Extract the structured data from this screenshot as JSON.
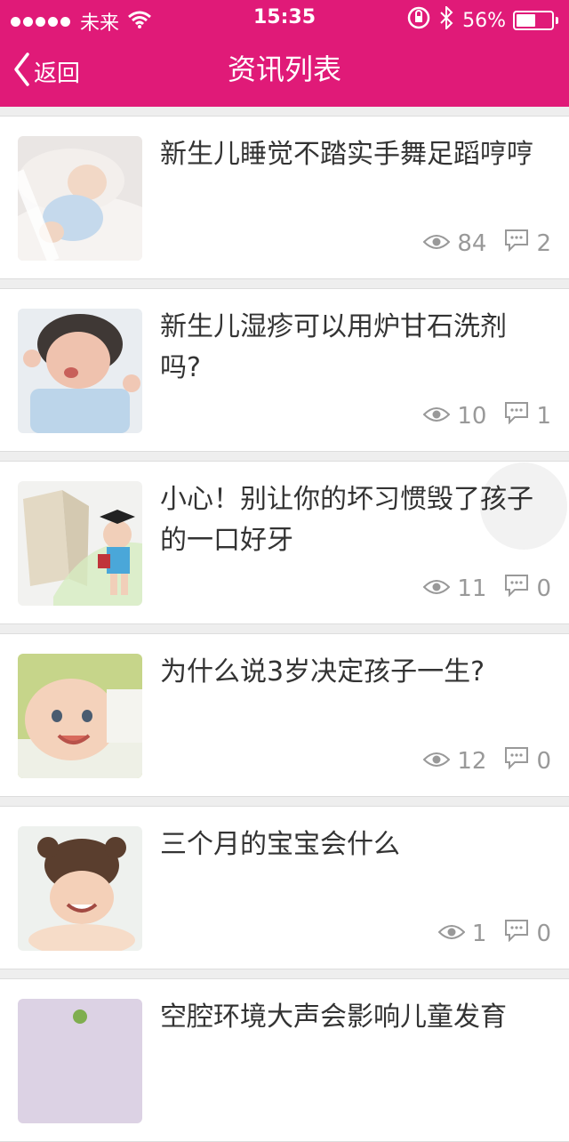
{
  "status_bar": {
    "carrier": "未来",
    "time": "15:35",
    "battery_percent_label": "56%",
    "battery_level": 0.56
  },
  "nav": {
    "back_label": "返回",
    "title": "资讯列表"
  },
  "articles": [
    {
      "title": "新生儿睡觉不踏实手舞足蹈哼哼",
      "views": "84",
      "comments": "2"
    },
    {
      "title": "新生儿湿疹可以用炉甘石洗剂吗?",
      "views": "10",
      "comments": "1"
    },
    {
      "title": "小心！别让你的坏习惯毁了孩子的一口好牙",
      "views": "11",
      "comments": "0"
    },
    {
      "title": "为什么说3岁决定孩子一生?",
      "views": "12",
      "comments": "0"
    },
    {
      "title": "三个月的宝宝会什么",
      "views": "1",
      "comments": "0"
    },
    {
      "title": "空腔环境大声会影响儿童发育",
      "views": "",
      "comments": ""
    }
  ],
  "colors": {
    "brand": "#e01a78",
    "meta": "#999999",
    "title_text": "#333333"
  }
}
